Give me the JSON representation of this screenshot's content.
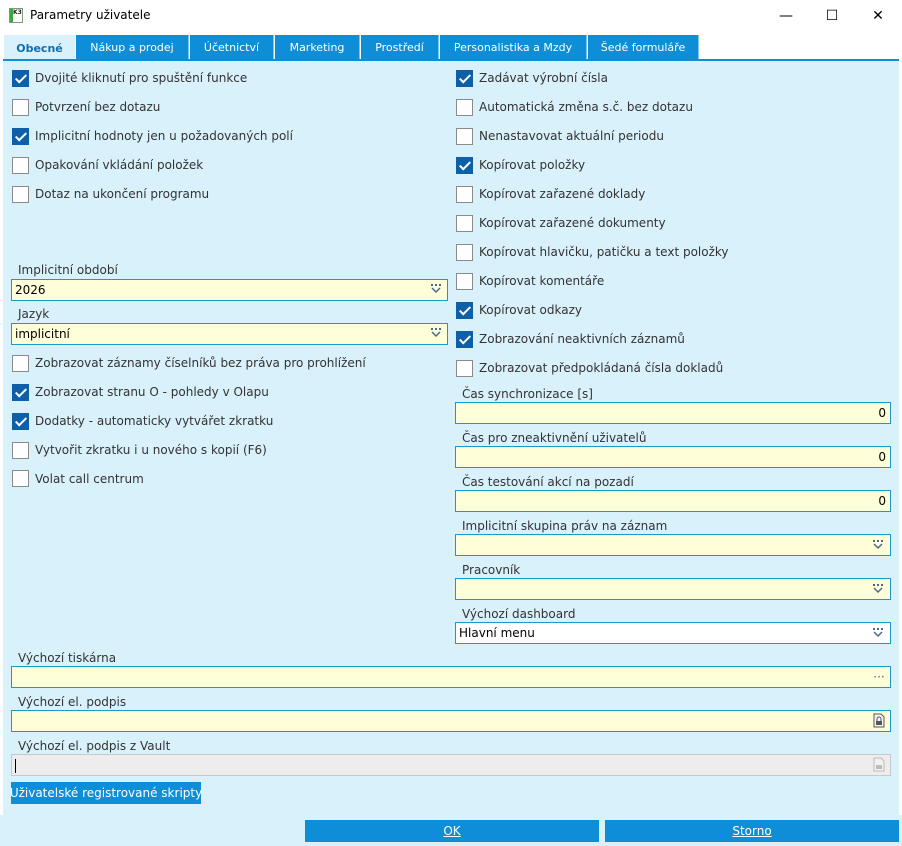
{
  "window": {
    "title": "Parametry uživatele",
    "icon_text": "K3",
    "controls": {
      "minimize": "—",
      "maximize": "☐",
      "close": "✕"
    }
  },
  "tabs": [
    {
      "label": "Obecné",
      "active": true
    },
    {
      "label": "Nákup a prodej",
      "active": false
    },
    {
      "label": "Účetnictví",
      "active": false
    },
    {
      "label": "Marketing",
      "active": false
    },
    {
      "label": "Prostředí",
      "active": false
    },
    {
      "label": "Personalistika a Mzdy",
      "active": false
    },
    {
      "label": "Šedé formuláře",
      "active": false
    }
  ],
  "left_checks": [
    {
      "label": "Dvojité kliknutí pro spuštění funkce",
      "checked": true
    },
    {
      "label": "Potvrzení bez dotazu",
      "checked": false
    },
    {
      "label": "Implicitní hodnoty jen u požadovaných polí",
      "checked": true
    },
    {
      "label": "Opakování vkládání položek",
      "checked": false
    },
    {
      "label": "Dotaz na ukončení programu",
      "checked": false
    }
  ],
  "period": {
    "label": "Implicitní období",
    "value": "2026"
  },
  "language": {
    "label": "Jazyk",
    "value": "implicitní"
  },
  "left_checks2": [
    {
      "label": "Zobrazovat záznamy číselníků bez práva pro prohlížení",
      "checked": false
    },
    {
      "label": "Zobrazovat stranu O - pohledy v Olapu",
      "checked": true
    },
    {
      "label": "Dodatky - automaticky vytvářet zkratku",
      "checked": true
    },
    {
      "label": "Vytvořit zkratku i u nového s kopií (F6)",
      "checked": false
    },
    {
      "label": "Volat call centrum",
      "checked": false
    }
  ],
  "right_checks": [
    {
      "label": "Zadávat výrobní čísla",
      "checked": true
    },
    {
      "label": "Automatická změna s.č. bez dotazu",
      "checked": false
    },
    {
      "label": "Nenastavovat aktuální periodu",
      "checked": false
    },
    {
      "label": "Kopírovat položky",
      "checked": true
    },
    {
      "label": "Kopírovat zařazené doklady",
      "checked": false
    },
    {
      "label": "Kopírovat zařazené dokumenty",
      "checked": false
    },
    {
      "label": "Kopírovat hlavičku, patičku a text položky",
      "checked": false
    },
    {
      "label": "Kopírovat komentáře",
      "checked": false
    },
    {
      "label": "Kopírovat odkazy",
      "checked": true
    },
    {
      "label": "Zobrazování neaktivních záznamů",
      "checked": true
    },
    {
      "label": "Zobrazovat předpokládaná čísla dokladů",
      "checked": false
    }
  ],
  "sync_time": {
    "label": "Čas synchronizace [s]",
    "value": "0"
  },
  "deactivate_time": {
    "label": "Čas pro zneaktivnění uživatelů",
    "value": "0"
  },
  "bg_test_time": {
    "label": "Čas testování akcí na pozadí",
    "value": "0"
  },
  "rights_group": {
    "label": "Implicitní skupina práv na záznam",
    "value": ""
  },
  "worker": {
    "label": "Pracovník",
    "value": ""
  },
  "dashboard": {
    "label": "Výchozí dashboard",
    "value": "Hlavní menu"
  },
  "printer": {
    "label": "Výchozí tiskárna",
    "value": "",
    "button": "···"
  },
  "signature": {
    "label": "Výchozí el. podpis",
    "value": ""
  },
  "vault_signature": {
    "label": "Výchozí el. podpis z Vault",
    "value": ""
  },
  "scripts_button": "Uživatelské registrované skripty",
  "footer": {
    "ok": "OK",
    "cancel": "Storno"
  },
  "colors": {
    "accent": "#0e8ed6",
    "panel": "#d9f1fb",
    "field": "#fefed8",
    "checked": "#0d5fa8"
  }
}
